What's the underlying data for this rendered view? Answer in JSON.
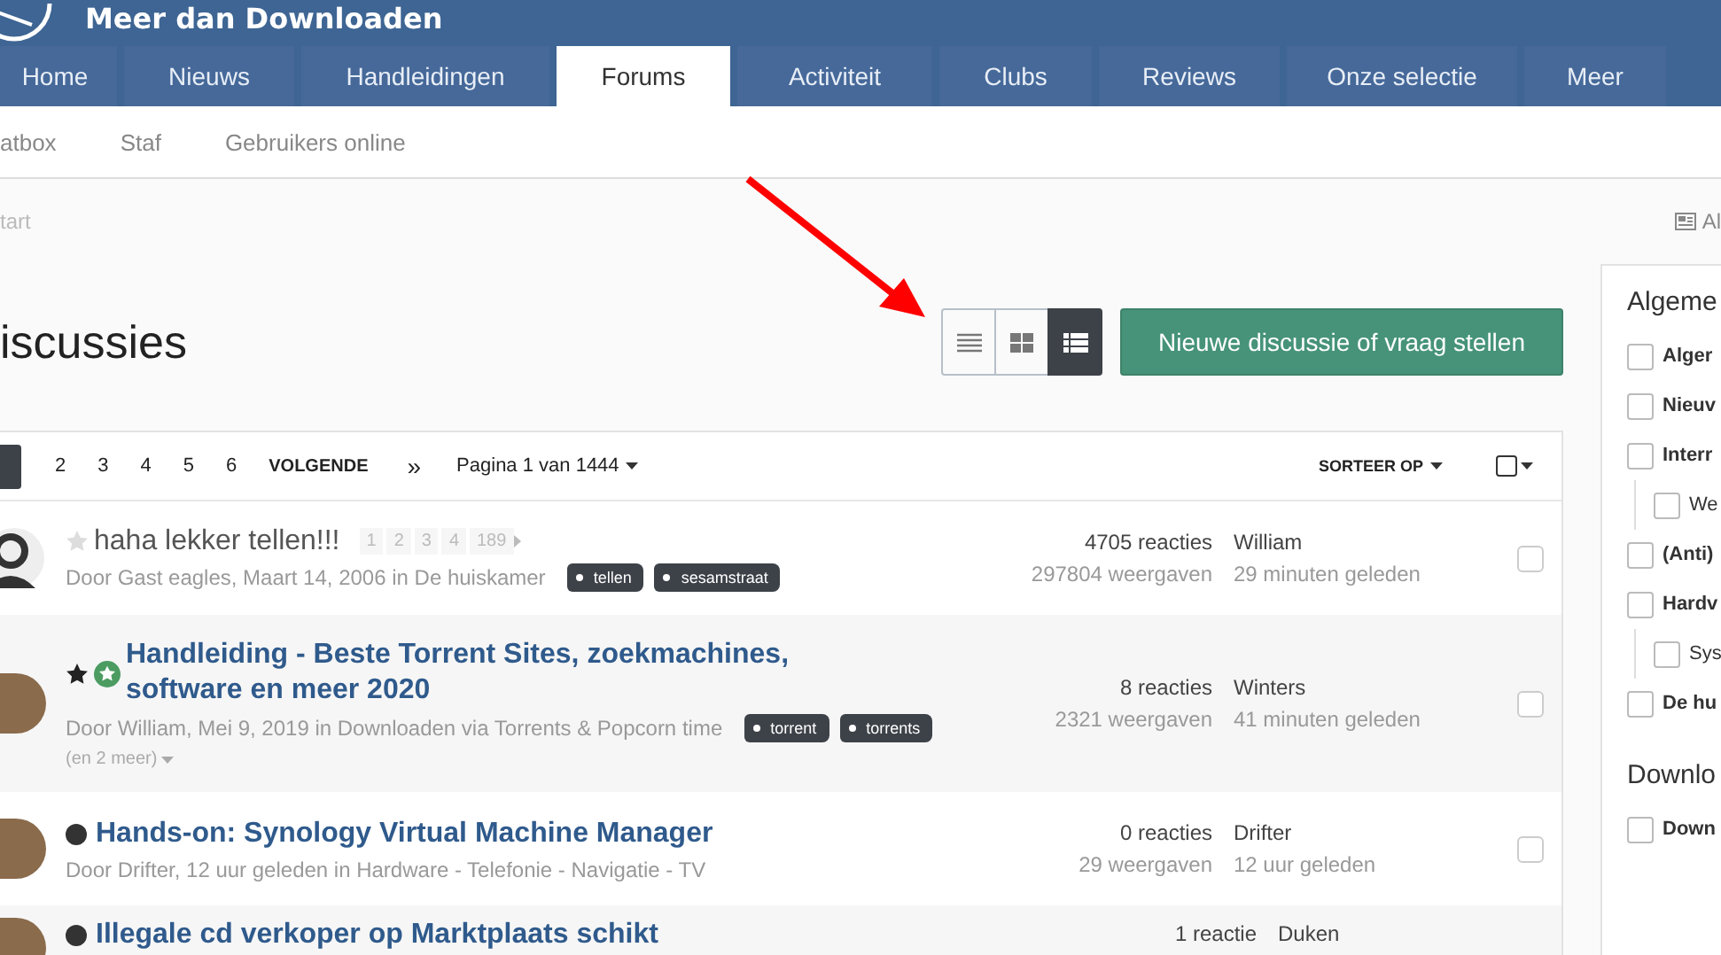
{
  "site": {
    "title": "Meer dan Downloaden"
  },
  "nav_tabs": [
    {
      "label": "Home",
      "selected": false
    },
    {
      "label": "Nieuws",
      "selected": false
    },
    {
      "label": "Handleidingen",
      "selected": false
    },
    {
      "label": "Forums",
      "selected": true
    },
    {
      "label": "Activiteit",
      "selected": false
    },
    {
      "label": "Clubs",
      "selected": false
    },
    {
      "label": "Reviews",
      "selected": false
    },
    {
      "label": "Onze selectie",
      "selected": false
    },
    {
      "label": "Meer",
      "selected": false
    }
  ],
  "sub_nav": [
    "atbox",
    "Staf",
    "Gebruikers online"
  ],
  "breadcrumb": {
    "text": "tart",
    "action": "Al"
  },
  "page_title": "iscussies",
  "view_modes": [
    {
      "kind": "list",
      "selected": false
    },
    {
      "kind": "grid",
      "selected": false
    },
    {
      "kind": "table",
      "selected": true
    }
  ],
  "new_button": "Nieuwe discussie of vraag stellen",
  "pagination": {
    "pages": [
      "2",
      "3",
      "4",
      "5",
      "6"
    ],
    "next": "VOLGENDE",
    "last": "»",
    "page_info": "Pagina 1 van 1444",
    "sort": "SORTEER OP",
    "select_all": {
      "checked": false
    }
  },
  "topics": [
    {
      "kind": "guest",
      "title": "haha lekker tellen!!!",
      "starred": false,
      "featured": false,
      "unread": false,
      "mini_pages": [
        "1",
        "2",
        "3",
        "4",
        "189"
      ],
      "meta": "Door Gast eagles, Maart 14, 2006 in De huiskamer",
      "tags": [
        "tellen",
        "sesamstraat"
      ],
      "replies": "4705 reacties",
      "views": "297804 weergaven",
      "last_user": "William",
      "last_time": "29 minuten geleden",
      "checked": false
    },
    {
      "kind": "member",
      "title": "Handleiding - Beste Torrent Sites, zoekmachines, software en meer 2020",
      "starred": true,
      "featured": true,
      "unread": false,
      "meta": "Door William, Mei 9, 2019 in Downloaden via Torrents & Popcorn time",
      "tags": [
        "torrent",
        "torrents"
      ],
      "more_tags": "(en 2 meer)",
      "replies": "8 reacties",
      "views": "2321 weergaven",
      "last_user": "Winters",
      "last_time": "41 minuten geleden",
      "checked": false
    },
    {
      "kind": "member",
      "title": "Hands-on: Synology Virtual Machine Manager",
      "featured": false,
      "unread": true,
      "meta": "Door Drifter, 12 uur geleden in Hardware - Telefonie - Navigatie - TV",
      "replies": "0 reacties",
      "views": "29 weergaven",
      "last_user": "Drifter",
      "last_time": "12 uur geleden",
      "checked": false
    },
    {
      "kind": "member",
      "title": "Illegale cd verkoper op Marktplaats schikt",
      "unread": true,
      "replies": "1 reactie",
      "last_user": "Duken"
    }
  ],
  "sidebar": {
    "sections": [
      {
        "heading": "Algeme",
        "items": [
          {
            "label": "Alger",
            "checked": false
          },
          {
            "label": "Nieuv",
            "checked": false
          },
          {
            "label": "Interr",
            "checked": false,
            "children": [
              {
                "label": "We",
                "checked": false
              }
            ]
          },
          {
            "label": "(Anti)",
            "checked": false
          },
          {
            "label": "Hardv",
            "checked": false,
            "children": [
              {
                "label": "Sys",
                "checked": false
              }
            ]
          },
          {
            "label": "De hu",
            "checked": false
          }
        ]
      },
      {
        "heading": "Downlo",
        "items": [
          {
            "label": "Down",
            "checked": false
          }
        ]
      }
    ]
  }
}
